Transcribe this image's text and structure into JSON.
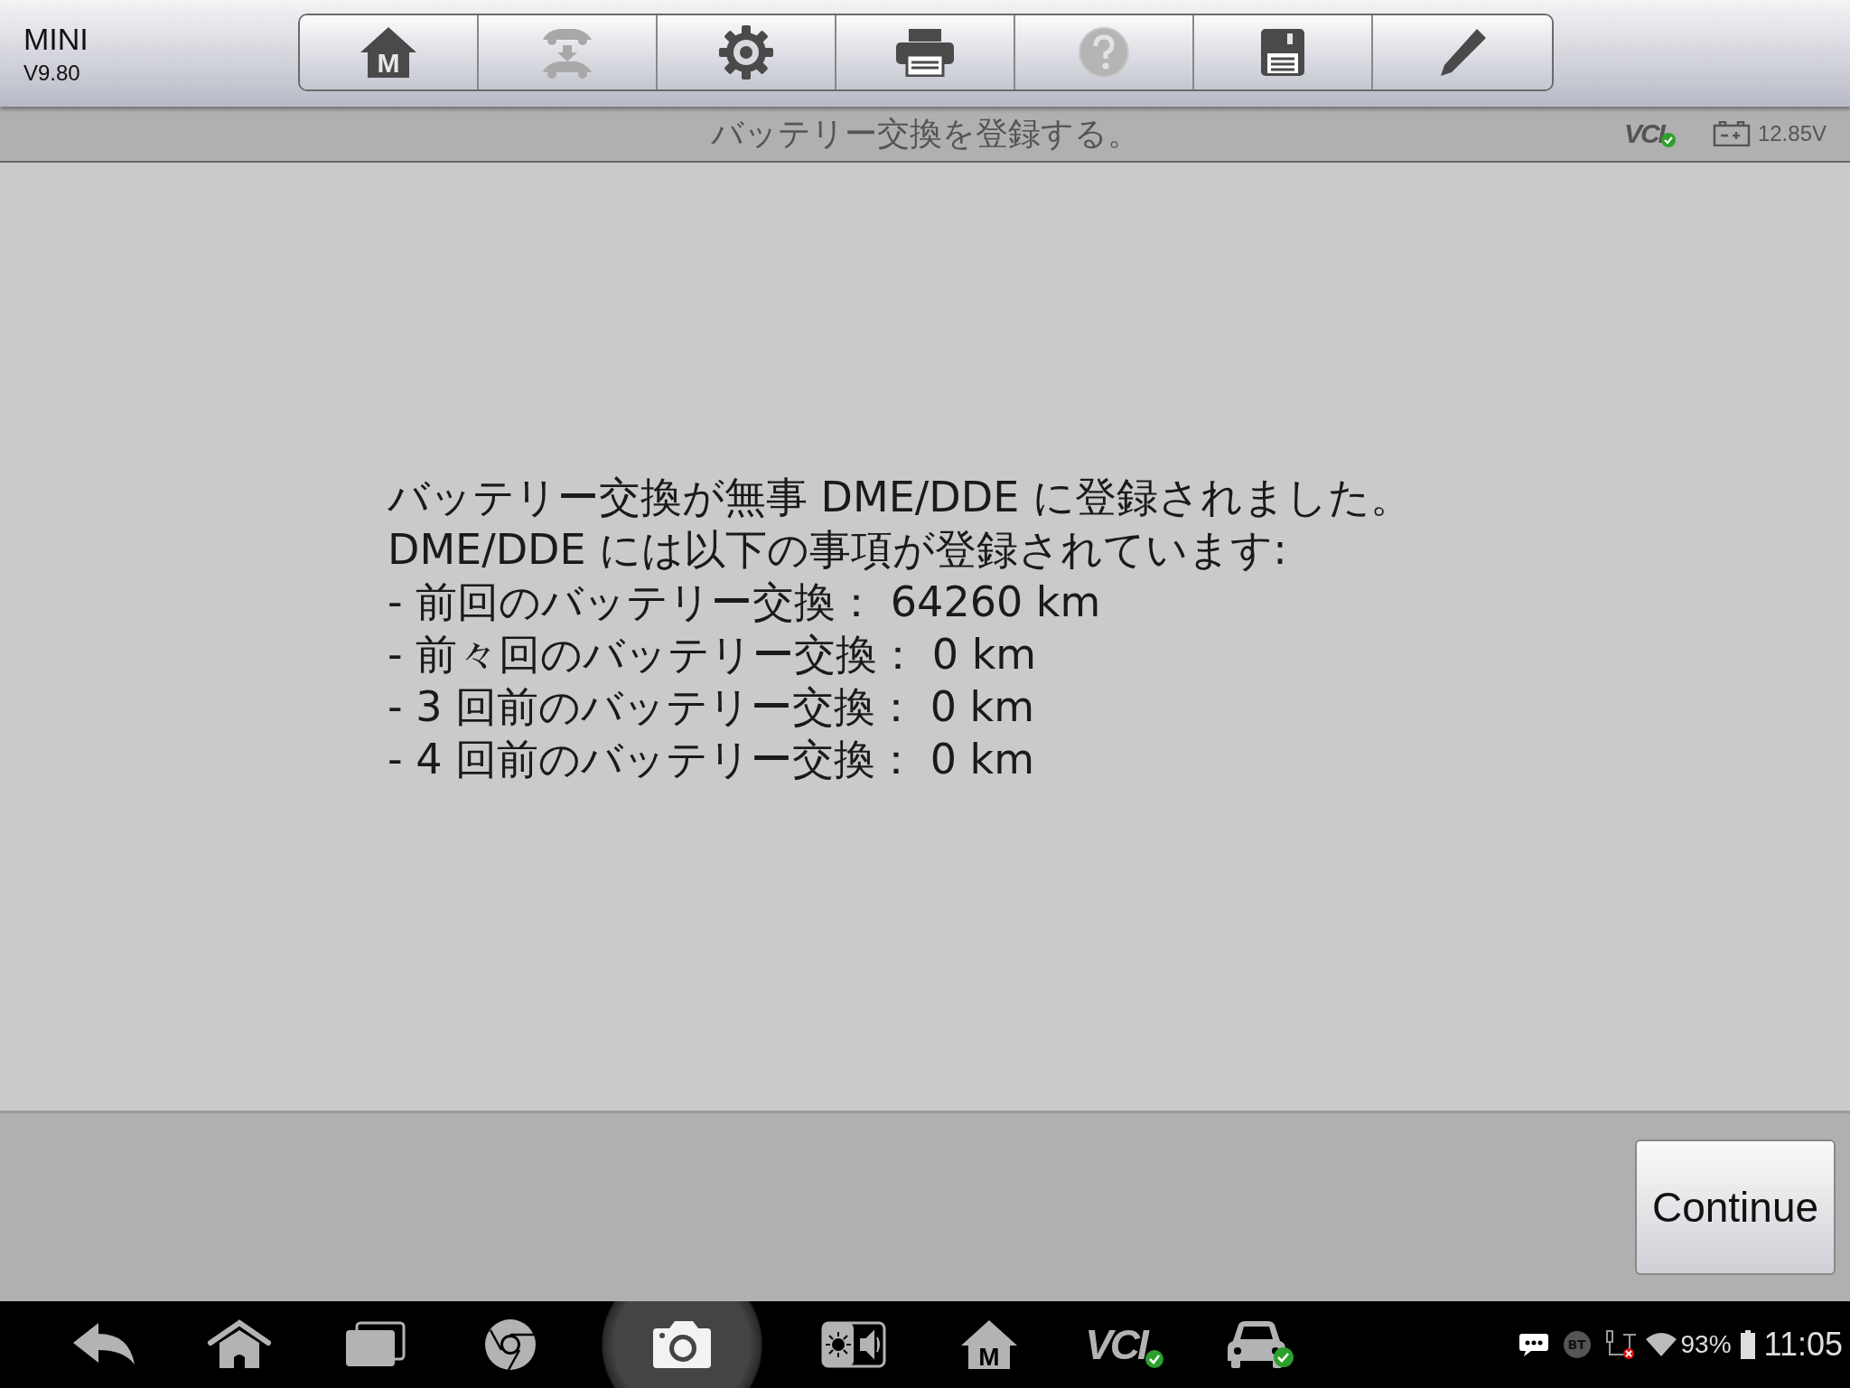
{
  "app": {
    "title": "MINI",
    "version": "V9.80"
  },
  "toolbar": [
    {
      "kind": "home",
      "label": "M",
      "disabled": false
    },
    {
      "kind": "car-transfer",
      "disabled": true
    },
    {
      "kind": "gear",
      "disabled": false
    },
    {
      "kind": "printer",
      "disabled": false
    },
    {
      "kind": "help",
      "disabled": true
    },
    {
      "kind": "save",
      "disabled": false
    },
    {
      "kind": "pencil",
      "disabled": false
    }
  ],
  "header": {
    "title": "バッテリー交換を登録する。",
    "vci": "VCI",
    "vci_connected": true,
    "voltage": "12.85V"
  },
  "message": [
    "バッテリー交換が無事 DME/DDE に登録されました。",
    "DME/DDE には以下の事項が登録されています:",
    "- 前回のバッテリー交換： 64260 km",
    "- 前々回のバッテリー交換： 0 km",
    "- 3 回前のバッテリー交換： 0 km",
    "- 4 回前のバッテリー交換： 0 km"
  ],
  "buttons": [
    {
      "label": "Continue"
    }
  ],
  "taskbar": [
    {
      "kind": "back",
      "selected": false
    },
    {
      "kind": "home",
      "selected": false
    },
    {
      "kind": "recents",
      "selected": false
    },
    {
      "kind": "browser",
      "selected": false
    },
    {
      "kind": "camera",
      "selected": true
    },
    {
      "kind": "brightness-volume",
      "selected": false
    },
    {
      "kind": "home-m",
      "label": "M",
      "selected": false
    },
    {
      "kind": "vci",
      "label": "VCI",
      "selected": false
    },
    {
      "kind": "car",
      "selected": false
    }
  ],
  "status_bar": {
    "bt": "BT",
    "battery": "93%",
    "time": "11:05"
  }
}
